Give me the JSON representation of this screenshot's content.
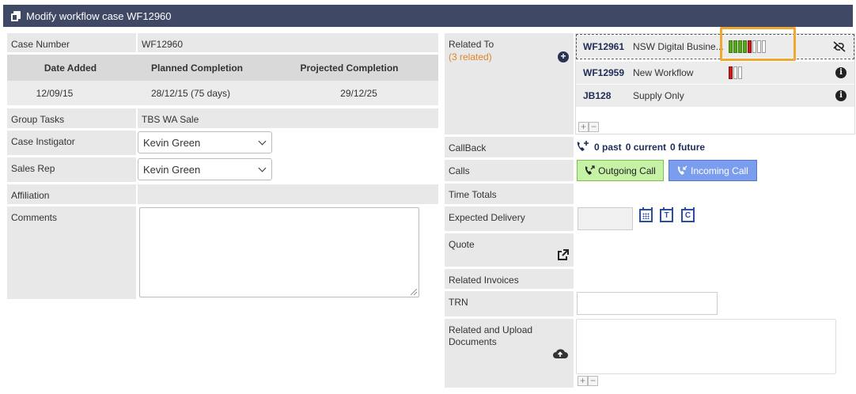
{
  "window": {
    "title": "Modify workflow case WF12960"
  },
  "left": {
    "case_number_label": "Case Number",
    "case_number": "WF12960",
    "dates": {
      "date_added_header": "Date Added",
      "planned_header": "Planned Completion",
      "projected_header": "Projected Completion",
      "date_added": "12/09/15",
      "planned": "28/12/15 (75 days)",
      "projected": "29/12/25"
    },
    "group_tasks_label": "Group Tasks",
    "group_tasks": "TBS WA Sale",
    "instigator_label": "Case Instigator",
    "instigator": "Kevin Green",
    "sales_rep_label": "Sales Rep",
    "sales_rep": "Kevin Green",
    "affiliation_label": "Affiliation",
    "comments_label": "Comments"
  },
  "right": {
    "related_label": "Related To",
    "related_count": "(3 related)",
    "related": [
      {
        "id": "WF12961",
        "name": "NSW Digital Busine...",
        "bars": [
          "g",
          "g",
          "g",
          "g",
          "r",
          "e",
          "e",
          "e"
        ],
        "action": "unlink-icon"
      },
      {
        "id": "WF12959",
        "name": "New Workflow",
        "bars": [
          "r",
          "e",
          "e"
        ],
        "action": "info-icon"
      },
      {
        "id": "JB128",
        "name": "Supply Only",
        "bars": [],
        "action": "info-icon"
      }
    ],
    "callback_label": "CallBack",
    "callback_past": "0 past",
    "callback_current": "0 current",
    "callback_future": "0 future",
    "calls_label": "Calls",
    "outgoing_call": "Outgoing Call",
    "incoming_call": "Incoming Call",
    "time_totals_label": "Time Totals",
    "expected_delivery_label": "Expected Delivery",
    "cal_t": "T",
    "cal_c": "C",
    "quote_label": "Quote",
    "related_invoices_label": "Related Invoices",
    "trn_label": "TRN",
    "documents_label": "Related and Upload Documents",
    "plus": "+",
    "minus": "−",
    "info_glyph": "i"
  },
  "colors": {
    "titlebar": "#3f4864",
    "accent_highlight": "#f0a830",
    "outgoing_bg": "#c6f2a6",
    "incoming_bg": "#7b9ded",
    "bar_green": "#5aa51e",
    "bar_red": "#c42020"
  }
}
